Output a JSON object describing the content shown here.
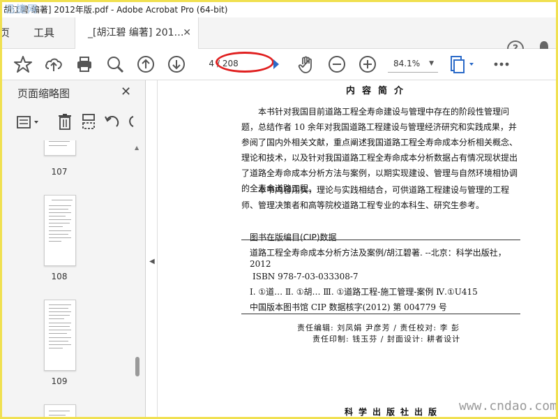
{
  "window": {
    "title": "胡江碧 编著] 2012年版.pdf - Adobe Acrobat Pro (64-bit)",
    "watermark_logo": "迅捷网"
  },
  "tabs": {
    "home": "页",
    "tools": "工具",
    "document": "_[胡江碧 编著] 201…",
    "close": "✕"
  },
  "header_icons": {
    "help": "?",
    "help_icon": "help-icon",
    "bell_icon": "bell-icon"
  },
  "toolbar": {
    "icons": [
      "star-icon",
      "upload-icon",
      "print-icon",
      "search-icon",
      "page-up-icon",
      "page-down-icon",
      "hand-icon",
      "zoom-out-icon",
      "zoom-in-icon",
      "page-fit-icon",
      "more-icon"
    ],
    "current_page": "4",
    "total_pages": "/ 208",
    "zoom": "84.1%"
  },
  "left_pane": {
    "title": "页面缩略图",
    "close": "✕",
    "tool_icons": [
      "options-icon",
      "delete-icon",
      "extract-icon",
      "undo-icon",
      "redo-icon"
    ],
    "thumbnails": [
      {
        "label": "107"
      },
      {
        "label": "108"
      },
      {
        "label": "109"
      }
    ]
  },
  "document": {
    "heading": "内容简介",
    "intro_p1": "本书针对我国目前道路工程全寿命建设与管理中存在的阶段性管理问题，总结作者 10 余年对我国道路工程建设与管理经济研究和实践成果，并参阅了国内外相关文献，重点阐述我国道路工程全寿命成本分析相关概念、理论和技术，以及针对我国道路工程全寿命成本分析数据占有情况现状提出了道路全寿命成本分析方法与案例，以期实现建设、管理与自然环境相协调的全寿命道路工程。",
    "intro_p2": "本书内容翔实，理论与实践相结合，可供道路工程建设与管理的工程师、管理决策者和高等院校道路工程专业的本科生、研究生参考。",
    "cip_title": "图书在版编目(CIP)数据",
    "cip_line_a": "道路工程全寿命成本分析方法及案例/胡江碧著. --北京：科学出版社，",
    "cip_line_a2": "2012",
    "cip_isbn": "ISBN 978-7-03-033308-7",
    "cip_class": "Ⅰ. ①道…   Ⅱ. ①胡…   Ⅲ. ①道路工程-施工管理-案例   Ⅳ.①U415",
    "cip_record": "中国版本图书馆 CIP 数据核字(2012) 第 004779 号",
    "credit_1": "责任编辑: 刘凤娟   尹彦芳 / 责任校对: 李   彭",
    "credit_2": "责任印制: 钱玉芬 / 封面设计: 耕者设计",
    "publisher": "科学出版社出版",
    "watermark": "www.cndao.com"
  },
  "colors": {
    "annotation_ring": "#e02020",
    "frame": "#f0e050"
  }
}
